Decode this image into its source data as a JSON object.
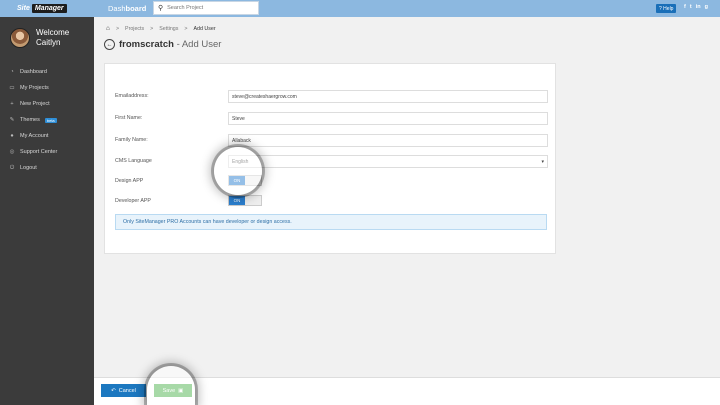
{
  "topbar": {
    "logo_site": "Site",
    "logo_manager": "Manager",
    "dashboard_prefix": "Dash",
    "dashboard_suffix": "board",
    "search_placeholder": "Search Project",
    "help_label": "Help",
    "social": [
      "f",
      "t",
      "in",
      "g"
    ]
  },
  "sidebar": {
    "welcome": "Welcome",
    "user_name": "Caitlyn",
    "items": [
      {
        "label": "Dashboard",
        "icon": "dashboard-icon",
        "glyph": "◔"
      },
      {
        "label": "My Projects",
        "icon": "monitor-icon",
        "glyph": "▭"
      },
      {
        "label": "New Project",
        "icon": "plus-icon",
        "glyph": "+"
      },
      {
        "label": "Themes",
        "icon": "brush-icon",
        "glyph": "✎",
        "badge": "beta"
      },
      {
        "label": "My Account",
        "icon": "user-icon",
        "glyph": "●"
      },
      {
        "label": "Support Center",
        "icon": "lifebuoy-icon",
        "glyph": "◎"
      },
      {
        "label": "Logout",
        "icon": "power-icon",
        "glyph": "⏻"
      }
    ]
  },
  "breadcrumb": {
    "items": [
      "Projects",
      "Settings",
      "Add User"
    ],
    "separator": ">"
  },
  "page": {
    "project": "fromscratch",
    "subtitle": "- Add User"
  },
  "form": {
    "email_label": "Emailaddress:",
    "email_value": "steve@createshaergrow.com",
    "first_name_label": "First Name:",
    "first_name_value": "Steve",
    "family_name_label": "Family Name:",
    "family_name_value": "Allaback",
    "cms_language_label": "CMS Language",
    "cms_language_value": "English",
    "design_app_label": "Design APP",
    "design_app_state": "ON",
    "developer_app_label": "Developer APP",
    "developer_app_state": "ON",
    "notice": "Only SiteManager PRO Accounts can have developer or design access."
  },
  "footer": {
    "cancel_label": "Cancel",
    "save_label": "Save"
  },
  "colors": {
    "topbar": "#8cb8e0",
    "sidebar": "#3b3b3b",
    "primary": "#1c78c0",
    "success": "#4fb34f"
  }
}
